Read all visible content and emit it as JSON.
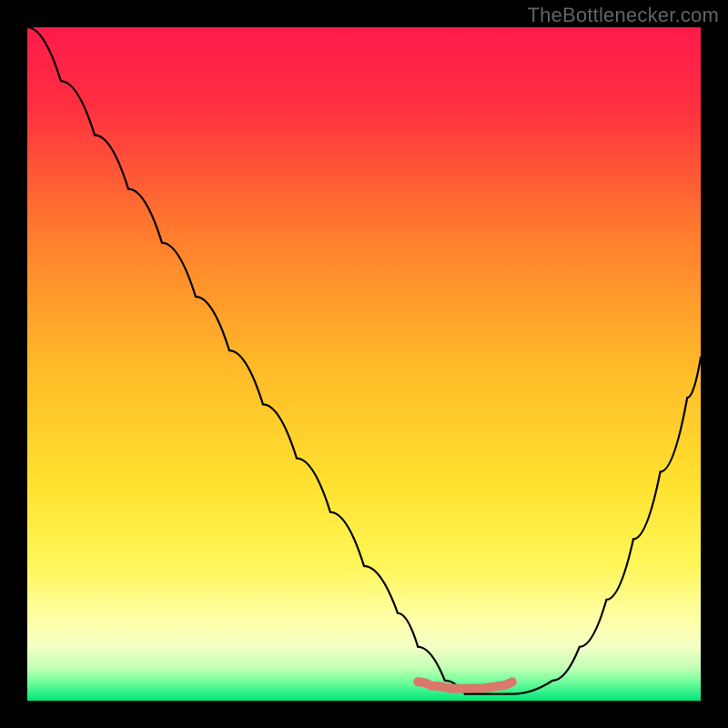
{
  "watermark": "TheBottlenecker.com",
  "chart_data": {
    "type": "line",
    "title": "",
    "xlabel": "",
    "ylabel": "",
    "xlim": [
      0,
      100
    ],
    "ylim": [
      0,
      100
    ],
    "background_gradient": {
      "top_color": "#ff1a4b",
      "mid_color": "#ffd633",
      "lower_color": "#ffff8c",
      "bottom_color": "#00e67a"
    },
    "series": [
      {
        "name": "bottleneck-curve",
        "color": "#000000",
        "x": [
          0,
          5,
          10,
          15,
          20,
          25,
          30,
          35,
          40,
          45,
          50,
          55,
          58,
          62,
          65,
          70,
          72,
          78,
          82,
          86,
          90,
          94,
          98,
          100
        ],
        "y": [
          100,
          92,
          84,
          76,
          68,
          60,
          52,
          44,
          36,
          28,
          20,
          13,
          8,
          3,
          1,
          1,
          1,
          3,
          8,
          15,
          24,
          34,
          45,
          51
        ]
      },
      {
        "name": "optimal-band",
        "color": "#d9786b",
        "x": [
          58,
          60,
          63,
          66,
          70,
          72
        ],
        "y": [
          2.8,
          2.2,
          1.8,
          1.8,
          2.2,
          2.8
        ]
      }
    ],
    "optimal_range_x": [
      58,
      72
    ]
  }
}
